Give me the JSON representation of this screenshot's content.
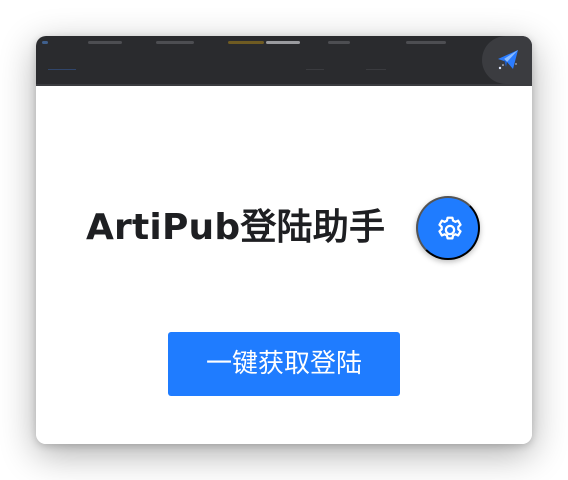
{
  "extension": {
    "icon": "paper-plane-icon"
  },
  "main": {
    "title": "ArtiPub登陆助手",
    "settings_icon": "gear-icon",
    "primary_button_label": "一键获取登陆"
  },
  "colors": {
    "toolbar_background": "#2a2b2e",
    "accent": "#1f7cff",
    "text": "#1e1f22",
    "background": "#ffffff"
  }
}
